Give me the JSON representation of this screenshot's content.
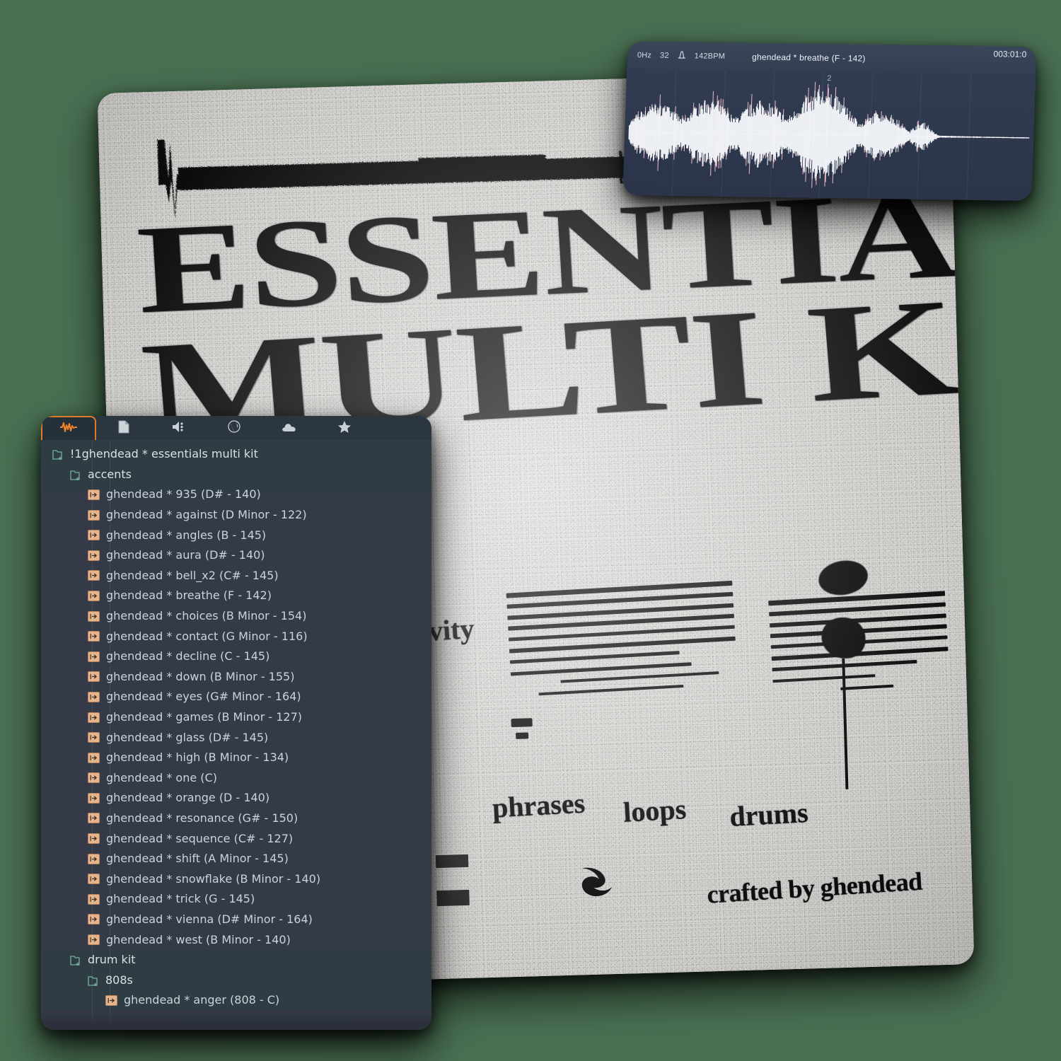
{
  "background_color": "#4a7052",
  "poster": {
    "title_line1": "ESSENTIALS",
    "title_line2": "MULTI KIT",
    "word_creativity": "creativity",
    "word_phrases": "phrases",
    "word_loops": "loops",
    "word_drums": "drums",
    "credit": "crafted by ghendead",
    "logo_name": "ghendead-logo-mark"
  },
  "audio_window": {
    "sample_rate": "0Hz",
    "bit_depth": "32",
    "bpm": "142BPM",
    "title": "ghendead * breathe (F - 142)",
    "timecode": "003:01:0",
    "bar_marker": "2",
    "waveform_color": "#f2f4f8",
    "waveform_accent": "#e8b6c2",
    "panel_color": "#2f3a4f"
  },
  "browser": {
    "accent_color": "#e07b28",
    "tabs": [
      {
        "label": "",
        "icon": "waveform-plugin-icon",
        "active": true
      },
      {
        "label": "",
        "icon": "file-page-icon",
        "active": false
      },
      {
        "label": "",
        "icon": "speaker-icon",
        "active": false
      },
      {
        "label": "",
        "icon": "globe-icon",
        "active": false
      },
      {
        "label": "",
        "icon": "cloud-icon",
        "active": false
      },
      {
        "label": "",
        "icon": "star-icon",
        "active": false
      }
    ],
    "rows": [
      {
        "type": "folder",
        "depth": 0,
        "label": "!1ghendead * essentials multi kit"
      },
      {
        "type": "folder",
        "depth": 1,
        "label": "accents"
      },
      {
        "type": "file",
        "depth": 2,
        "label": "ghendead * 935 (D# - 140)"
      },
      {
        "type": "file",
        "depth": 2,
        "label": "ghendead * against (D Minor - 122)"
      },
      {
        "type": "file",
        "depth": 2,
        "label": "ghendead * angles (B - 145)"
      },
      {
        "type": "file",
        "depth": 2,
        "label": "ghendead * aura (D# - 140)"
      },
      {
        "type": "file",
        "depth": 2,
        "label": "ghendead * bell_x2 (C# - 145)"
      },
      {
        "type": "file",
        "depth": 2,
        "label": "ghendead * breathe (F - 142)"
      },
      {
        "type": "file",
        "depth": 2,
        "label": "ghendead * choices (B Minor - 154)"
      },
      {
        "type": "file",
        "depth": 2,
        "label": "ghendead * contact (G Minor - 116)"
      },
      {
        "type": "file",
        "depth": 2,
        "label": "ghendead * decline (C - 145)"
      },
      {
        "type": "file",
        "depth": 2,
        "label": "ghendead * down (B Minor - 155)"
      },
      {
        "type": "file",
        "depth": 2,
        "label": "ghendead * eyes (G# Minor - 164)"
      },
      {
        "type": "file",
        "depth": 2,
        "label": "ghendead * games (B Minor - 127)"
      },
      {
        "type": "file",
        "depth": 2,
        "label": "ghendead * glass (D# - 145)"
      },
      {
        "type": "file",
        "depth": 2,
        "label": "ghendead * high (B Minor - 134)"
      },
      {
        "type": "file",
        "depth": 2,
        "label": "ghendead * one (C)"
      },
      {
        "type": "file",
        "depth": 2,
        "label": "ghendead * orange (D - 140)"
      },
      {
        "type": "file",
        "depth": 2,
        "label": "ghendead * resonance (G# - 150)"
      },
      {
        "type": "file",
        "depth": 2,
        "label": "ghendead * sequence (C# - 127)"
      },
      {
        "type": "file",
        "depth": 2,
        "label": "ghendead * shift (A Minor - 145)"
      },
      {
        "type": "file",
        "depth": 2,
        "label": "ghendead * snowflake (B Minor - 140)"
      },
      {
        "type": "file",
        "depth": 2,
        "label": "ghendead * trick (G - 145)"
      },
      {
        "type": "file",
        "depth": 2,
        "label": "ghendead * vienna (D# Minor - 164)"
      },
      {
        "type": "file",
        "depth": 2,
        "label": "ghendead * west (B Minor - 140)"
      },
      {
        "type": "folder",
        "depth": 1,
        "label": "drum kit"
      },
      {
        "type": "folder",
        "depth": 2,
        "label": "808s"
      },
      {
        "type": "file",
        "depth": 3,
        "label": "ghendead * anger (808 - C)"
      }
    ]
  }
}
